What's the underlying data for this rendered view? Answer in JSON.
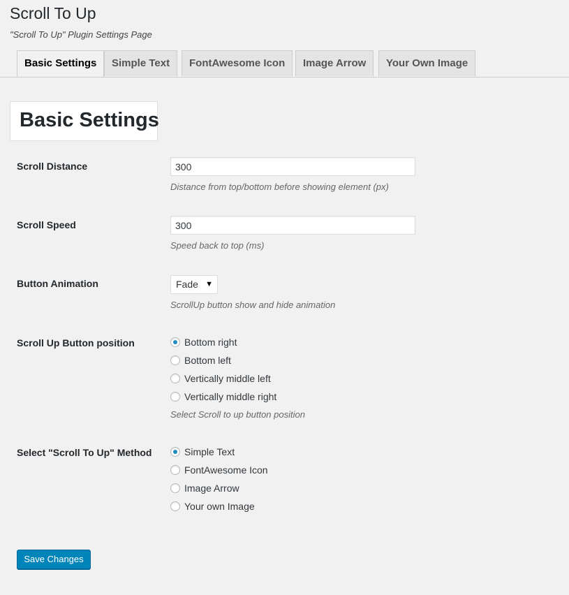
{
  "header": {
    "title": "Scroll To Up",
    "subtitle": "\"Scroll To Up\" Plugin Settings Page"
  },
  "tabs": [
    {
      "label": "Basic Settings",
      "active": true
    },
    {
      "label": "Simple Text",
      "active": false
    },
    {
      "label": "FontAwesome Icon",
      "active": false
    },
    {
      "label": "Image Arrow",
      "active": false
    },
    {
      "label": "Your Own Image",
      "active": false
    }
  ],
  "section": {
    "title": "Basic Settings"
  },
  "fields": {
    "scroll_distance": {
      "label": "Scroll Distance",
      "value": "300",
      "description": "Distance from top/bottom before showing element (px)"
    },
    "scroll_speed": {
      "label": "Scroll Speed",
      "value": "300",
      "description": "Speed back to top (ms)"
    },
    "button_animation": {
      "label": "Button Animation",
      "selected": "Fade",
      "description": "ScrollUp button show and hide animation"
    },
    "button_position": {
      "label": "Scroll Up Button position",
      "options": [
        {
          "label": "Bottom right",
          "checked": true
        },
        {
          "label": "Bottom left",
          "checked": false
        },
        {
          "label": "Vertically middle left",
          "checked": false
        },
        {
          "label": "Vertically middle right",
          "checked": false
        }
      ],
      "description": "Select Scroll to up button position"
    },
    "method": {
      "label": "Select \"Scroll To Up\" Method",
      "options": [
        {
          "label": "Simple Text",
          "checked": true
        },
        {
          "label": "FontAwesome Icon",
          "checked": false
        },
        {
          "label": "Image Arrow",
          "checked": false
        },
        {
          "label": "Your own Image",
          "checked": false
        }
      ]
    }
  },
  "actions": {
    "save_label": "Save Changes"
  },
  "colors": {
    "primary_button": "#0085ba",
    "radio_dot": "#1e8cbe",
    "background": "#f1f1f1"
  }
}
